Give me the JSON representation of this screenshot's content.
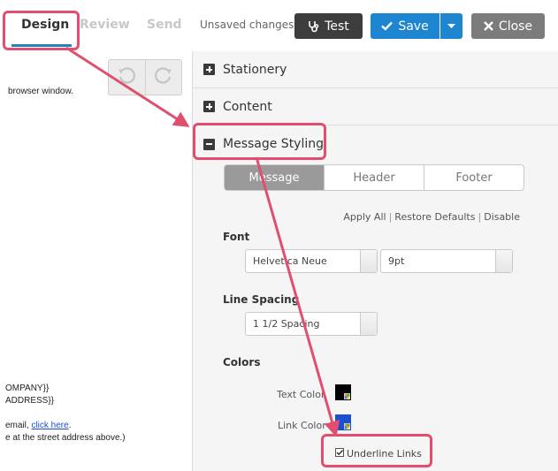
{
  "topbar": {
    "tabs": [
      {
        "label": "Design"
      },
      {
        "label": "Review"
      },
      {
        "label": "Send"
      }
    ],
    "unsaved": "Unsaved changes",
    "test_label": "Test",
    "save_label": "Save",
    "close_label": "Close"
  },
  "preview": {
    "line1": "browser window.",
    "company": "OMPANY}}",
    "address": "ADDRESS}}",
    "email_prefix": "email, ",
    "click_here": "click here",
    "email_suffix": ".",
    "street": "e at the street address above.)"
  },
  "panel": {
    "sections": [
      {
        "label": "Stationery"
      },
      {
        "label": "Content"
      },
      {
        "label": "Message Styling"
      }
    ],
    "segments": [
      "Message",
      "Header",
      "Footer"
    ],
    "actions": [
      "Apply All",
      "Restore Defaults",
      "Disable"
    ],
    "font_label": "Font",
    "font_family": "Helvetica Neue",
    "font_size": "9pt",
    "line_spacing_label": "Line Spacing",
    "line_spacing": "1 1/2 Spacing",
    "colors_label": "Colors",
    "text_color_label": "Text Color",
    "link_color_label": "Link Color",
    "underline_label": "Underline Links"
  },
  "colors": {
    "accent": "#1e86d0",
    "annotation": "#e0506e",
    "text_color_swatch": "#000000",
    "link_color_swatch": "#1a4fd0"
  }
}
